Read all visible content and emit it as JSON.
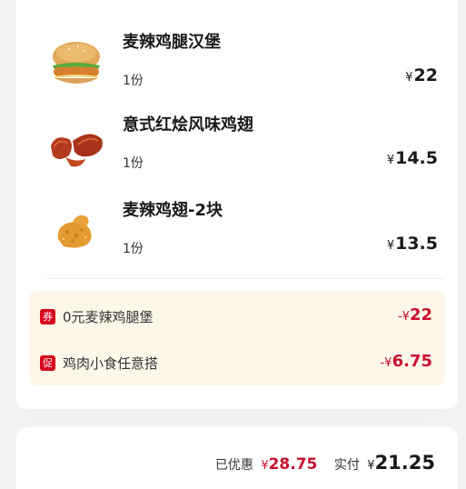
{
  "currency_symbol": "¥",
  "items": [
    {
      "name": "麦辣鸡腿汉堡",
      "qty": "1份",
      "price": "22",
      "icon": "burger-icon"
    },
    {
      "name": "意式红烩风味鸡翅",
      "qty": "1份",
      "price": "14.5",
      "icon": "chicken-wings-icon"
    },
    {
      "name": "麦辣鸡翅-2块",
      "qty": "1份",
      "price": "13.5",
      "icon": "fried-chicken-wing-icon"
    }
  ],
  "promotions": [
    {
      "badge": "券",
      "label": "0元麦辣鸡腿堡",
      "amount_prefix": "-¥",
      "amount": "22"
    },
    {
      "badge": "促",
      "label": "鸡肉小食任意搭",
      "amount_prefix": "-¥",
      "amount": "6.75"
    }
  ],
  "summary": {
    "discount_label": "已优惠",
    "discount_value": "28.75",
    "paid_label": "实付",
    "paid_value": "21.25"
  },
  "colors": {
    "accent_red": "#c8102e",
    "promo_bg": "#fdf7ea",
    "badge_red": "#d6001c"
  }
}
